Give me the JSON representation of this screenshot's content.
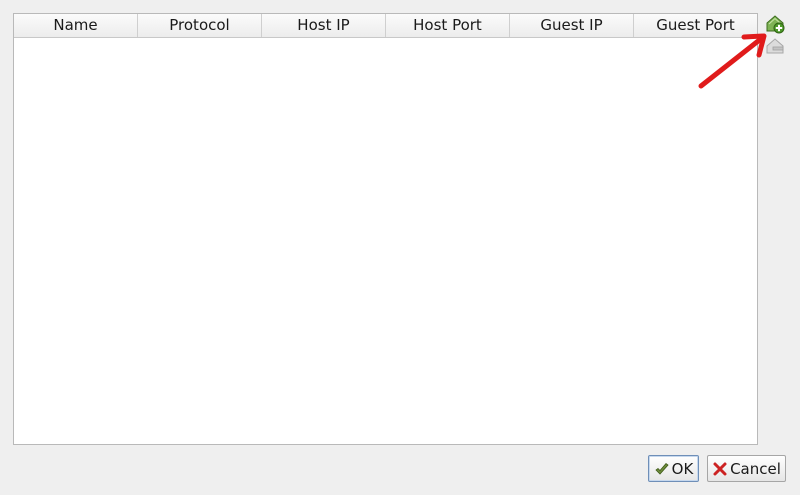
{
  "table": {
    "columns": [
      "Name",
      "Protocol",
      "Host IP",
      "Host Port",
      "Guest IP",
      "Guest Port"
    ],
    "rows": []
  },
  "tools": {
    "add_icon": "add-rule-icon",
    "remove_icon": "remove-rule-icon"
  },
  "buttons": {
    "ok_label": "OK",
    "ok_icon": "ok-check-icon",
    "cancel_label": "Cancel",
    "cancel_icon": "cancel-x-icon"
  },
  "colors": {
    "annotation_arrow": "#e01b1b",
    "add_icon_green": "#4e9a2a",
    "cancel_icon_red": "#cc2222"
  }
}
